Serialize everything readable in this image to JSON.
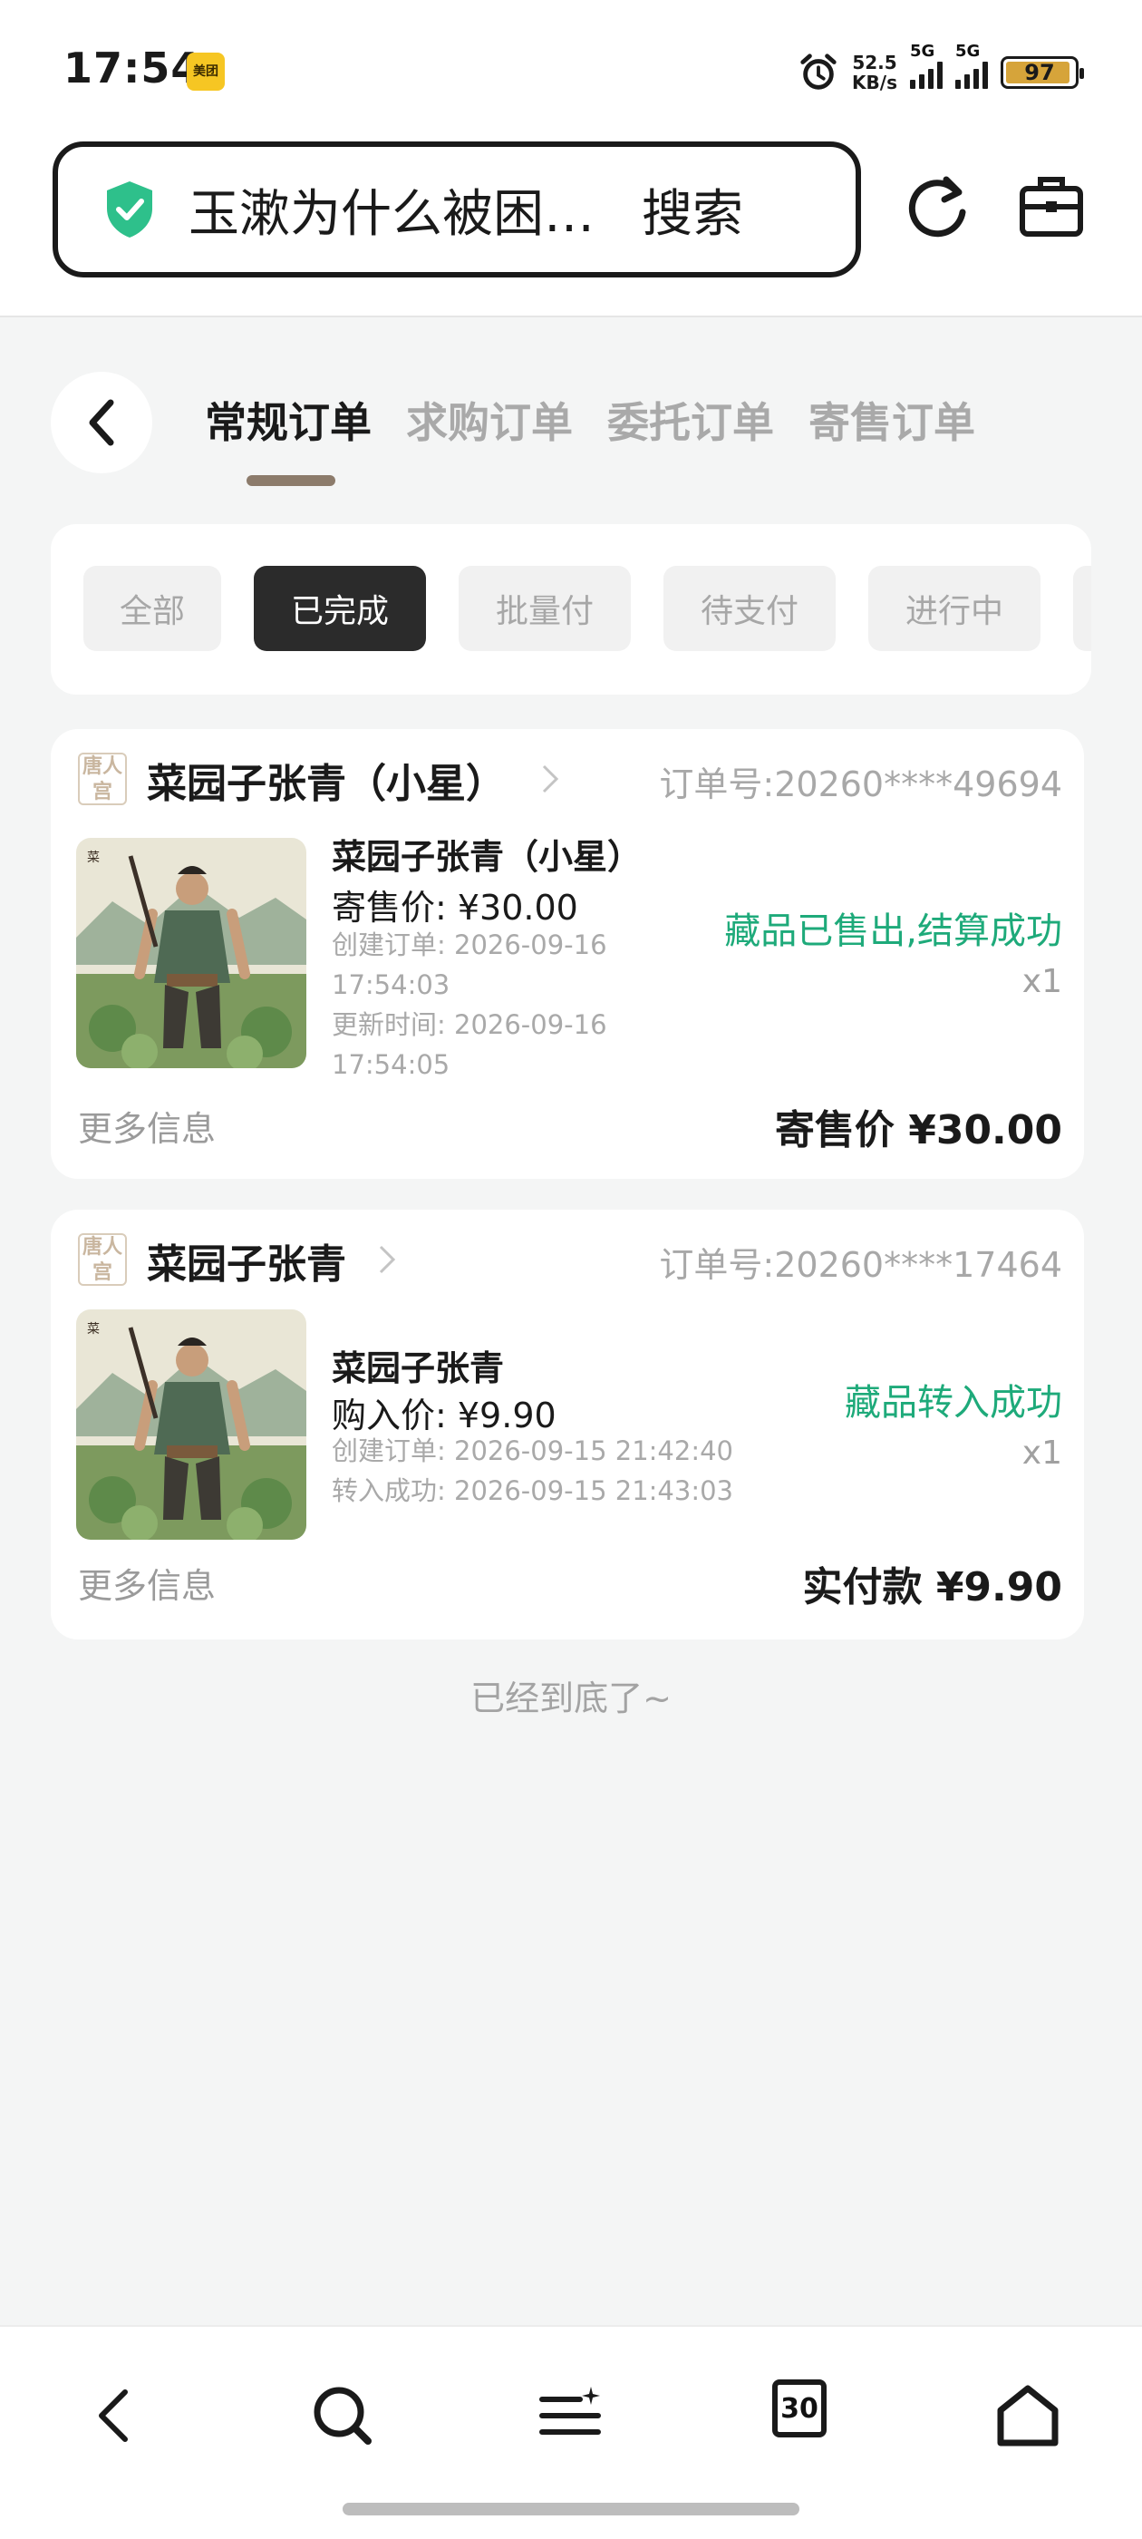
{
  "status_bar": {
    "time": "17:54",
    "app_badge": "美团",
    "net_speed_value": "52.5",
    "net_speed_unit": "KB/s",
    "sim1_label": "5G",
    "sim2_label": "5G",
    "battery": "97"
  },
  "browser": {
    "search_query": "玉漱为什么被困…",
    "search_button": "搜索"
  },
  "tabs": [
    {
      "label": "常规订单",
      "active": true
    },
    {
      "label": "求购订单",
      "active": false
    },
    {
      "label": "委托订单",
      "active": false
    },
    {
      "label": "寄售订单",
      "active": false
    }
  ],
  "filters": [
    {
      "label": "全部",
      "active": false
    },
    {
      "label": "已完成",
      "active": true
    },
    {
      "label": "批量付",
      "active": false
    },
    {
      "label": "待支付",
      "active": false
    },
    {
      "label": "进行中",
      "active": false
    }
  ],
  "orders": [
    {
      "shop_logo": "唐人宫",
      "shop_name": "菜园子张青（小星）",
      "order_no": "订单号:20260****49694",
      "item_title": "菜园子张青（小星）",
      "price_line": "寄售价: ¥30.00",
      "meta_1": "创建订单: 2026-09-16 17:54:03",
      "meta_2": "更新时间: 2026-09-16 17:54:05",
      "status": "藏品已售出,结算成功",
      "qty": "x1",
      "more_info": "更多信息",
      "total": "寄售价 ¥30.00"
    },
    {
      "shop_logo": "唐人宫",
      "shop_name": "菜园子张青",
      "order_no": "订单号:20260****17464",
      "item_title": "菜园子张青",
      "price_line": "购入价: ¥9.90",
      "meta_1": "创建订单: 2026-09-15 21:42:40",
      "meta_2": "转入成功: 2026-09-15 21:43:03",
      "status": "藏品转入成功",
      "qty": "x1",
      "more_info": "更多信息",
      "total": "实付款 ¥9.90"
    }
  ],
  "footer_note": "已经到底了~",
  "bottom_nav": {
    "tab_count": "30",
    "items": [
      "back-icon",
      "search-icon",
      "menu-icon",
      "tabs-icon",
      "home-icon"
    ]
  },
  "colors": {
    "accent_green": "#1eaa7a",
    "active_chip": "#2b2b2b",
    "tab_underline": "#8c7b6b",
    "background": "#f4f5f5"
  }
}
